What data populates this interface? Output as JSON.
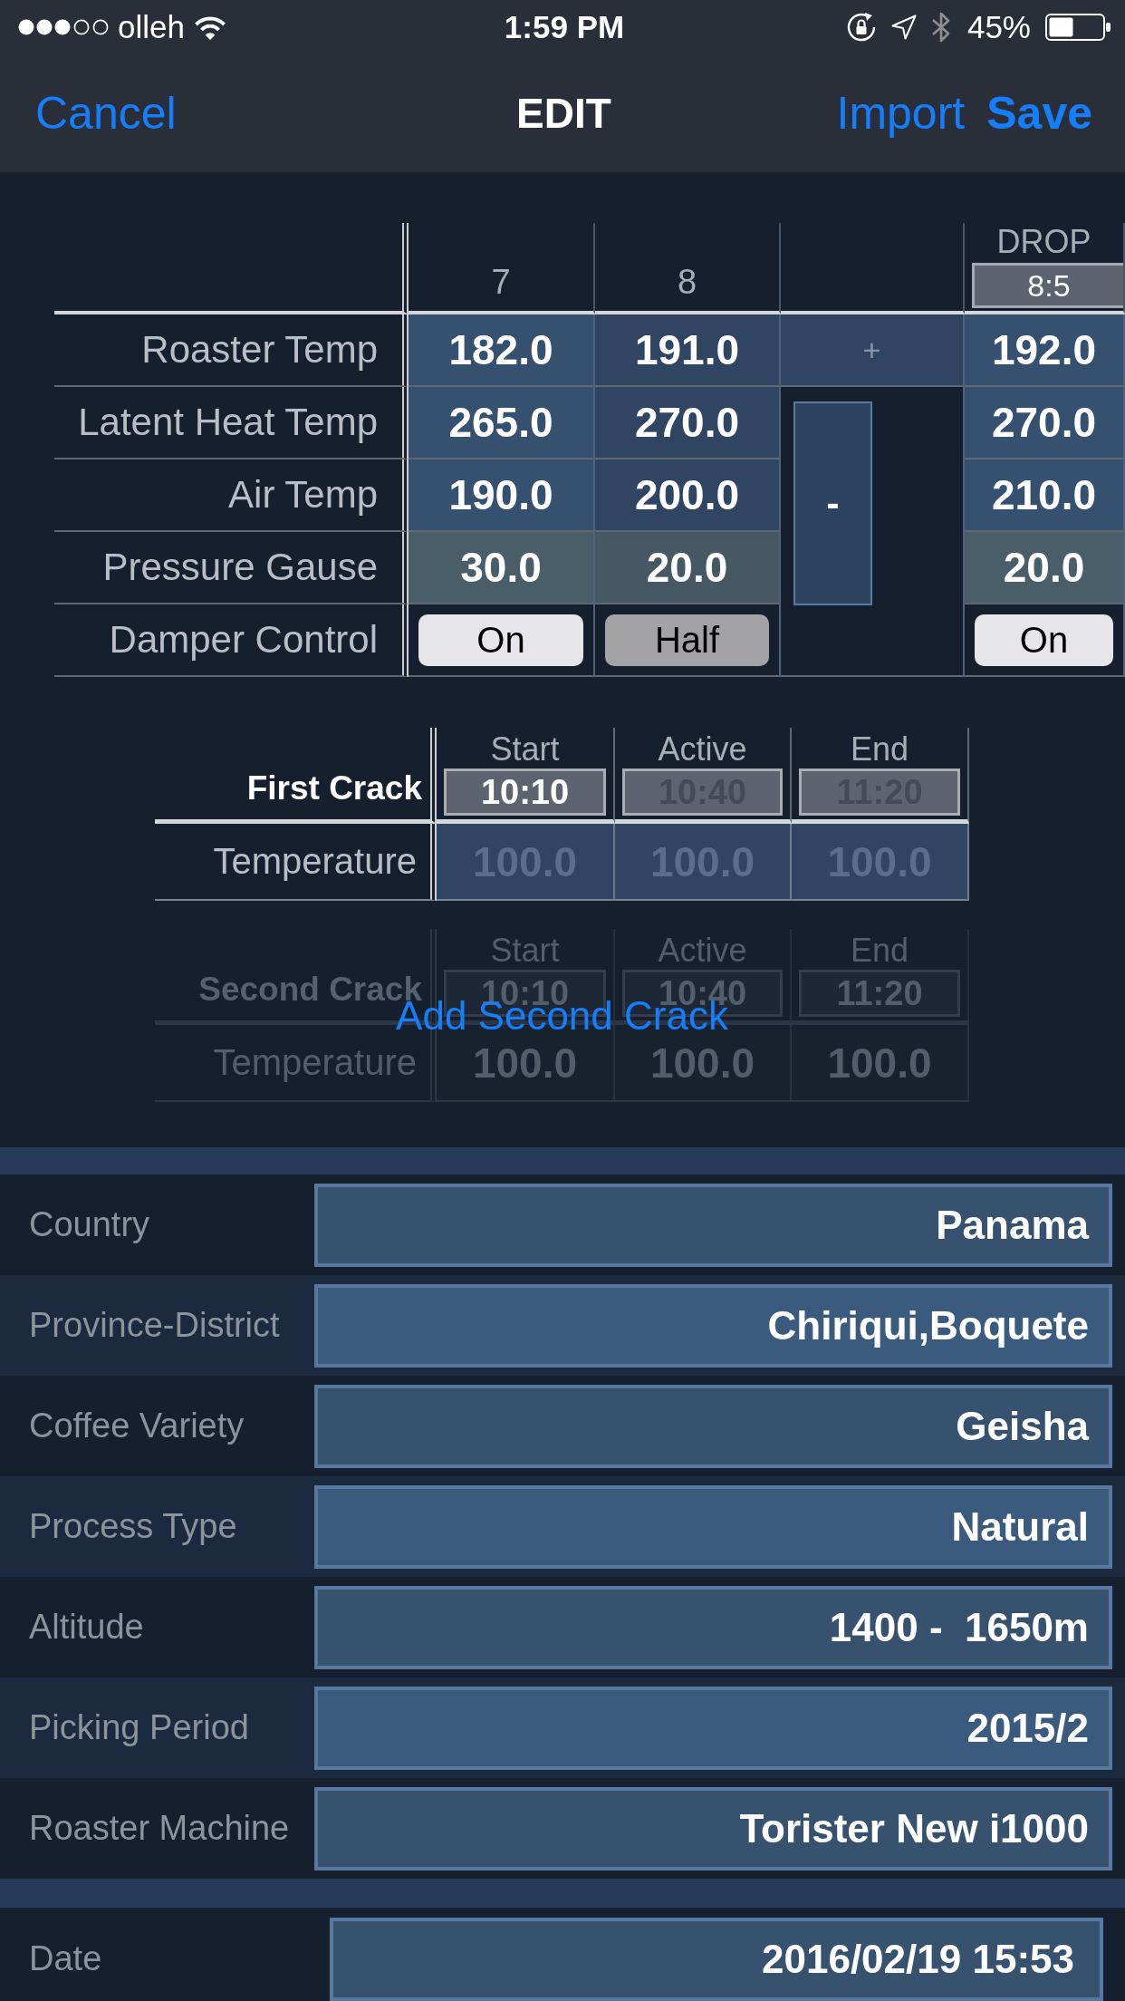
{
  "status_bar": {
    "carrier": "olleh",
    "time": "1:59 PM",
    "battery": "45%"
  },
  "nav_bar": {
    "cancel": "Cancel",
    "title": "EDIT",
    "import": "Import",
    "save": "Save"
  },
  "roast_table": {
    "columns": [
      {
        "kind": "data",
        "label": "7"
      },
      {
        "kind": "data",
        "label": "8"
      },
      {
        "kind": "controls",
        "add": "+",
        "remove": "-"
      },
      {
        "kind": "data",
        "label": "DROP",
        "time": "8:5"
      }
    ],
    "rows": [
      {
        "kind": "temperature",
        "label": "Roaster Temp",
        "values": [
          "182.0",
          "191.0",
          "192.0"
        ]
      },
      {
        "kind": "temperature",
        "label": "Latent Heat Temp",
        "values": [
          "265.0",
          "270.0",
          "270.0"
        ]
      },
      {
        "kind": "temperature",
        "label": "Air Temp",
        "values": [
          "190.0",
          "200.0",
          "210.0"
        ]
      },
      {
        "kind": "pressure",
        "label": "Pressure Gause",
        "values": [
          "30.0",
          "20.0",
          "20.0"
        ]
      },
      {
        "kind": "toggle",
        "label": "Damper Control",
        "values": [
          {
            "text": "On",
            "color": "#e5e5ea"
          },
          {
            "text": "Half",
            "color": "#a3a3a6"
          },
          {
            "text": "On",
            "color": "#e5e5ea"
          }
        ]
      }
    ]
  },
  "first_crack": {
    "title": "First Crack",
    "disabled": false,
    "columns": [
      {
        "label": "Start",
        "time": "10:10",
        "disabled": false
      },
      {
        "label": "Active",
        "time": "10:40",
        "disabled": true
      },
      {
        "label": "End",
        "time": "11:20",
        "disabled": true
      }
    ],
    "temperature": {
      "label": "Temperature",
      "values": [
        {
          "text": "100.0",
          "disabled": true
        },
        {
          "text": "100.0",
          "disabled": true
        },
        {
          "text": "100.0",
          "disabled": true
        }
      ]
    }
  },
  "second_crack": {
    "title": "Second Crack",
    "disabled": true,
    "columns": [
      {
        "label": "Start",
        "time": "10:10",
        "disabled": true
      },
      {
        "label": "Active",
        "time": "10:40",
        "disabled": true
      },
      {
        "label": "End",
        "time": "11:20",
        "disabled": true
      }
    ],
    "temperature": {
      "label": "Temperature",
      "values": [
        {
          "text": "100.0",
          "disabled": true
        },
        {
          "text": "100.0",
          "disabled": true
        },
        {
          "text": "100.0",
          "disabled": true
        }
      ]
    },
    "add_button": "Add Second Crack"
  },
  "details": [
    {
      "label": "Country",
      "value": "Panama"
    },
    {
      "label": "Province-District",
      "value": "Chiriqui,Boquete"
    },
    {
      "label": "Coffee Variety",
      "value": "Geisha"
    },
    {
      "label": "Process Type",
      "value": "Natural"
    },
    {
      "label": "Altitude",
      "value": "1400 -  1650m"
    },
    {
      "label": "Picking Period",
      "value": "2015/2"
    },
    {
      "label": "Roaster Machine",
      "value": "Torister New i1000"
    }
  ],
  "date": {
    "label": "Date",
    "value": "2016/02/19 15:53"
  }
}
